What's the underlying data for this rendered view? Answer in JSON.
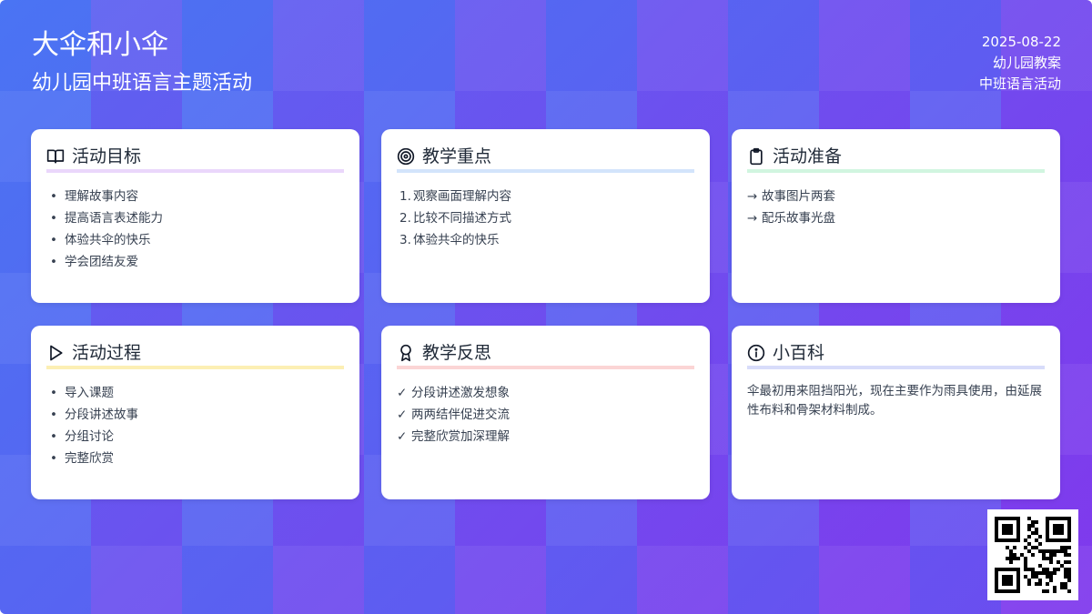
{
  "header": {
    "title": "大伞和小伞",
    "subtitle": "幼儿园中班语言主题活动",
    "date": "2025-08-22",
    "doc_type": "幼儿园教案",
    "activity_type": "中班语言活动"
  },
  "cards": {
    "goals": {
      "icon": "book-open-icon",
      "title": "活动目标",
      "items": [
        "理解故事内容",
        "提高语言表述能力",
        "体验共伞的快乐",
        "学会团结友爱"
      ]
    },
    "focus": {
      "icon": "target-icon",
      "title": "教学重点",
      "items": [
        {
          "num": "1.",
          "text": "观察画面理解内容"
        },
        {
          "num": "2.",
          "text": "比较不同描述方式"
        },
        {
          "num": "3.",
          "text": "体验共伞的快乐"
        }
      ]
    },
    "prep": {
      "icon": "clipboard-icon",
      "title": "活动准备",
      "items": [
        {
          "mark": "→",
          "text": "故事图片两套"
        },
        {
          "mark": "→",
          "text": "配乐故事光盘"
        }
      ]
    },
    "process": {
      "icon": "play-icon",
      "title": "活动过程",
      "items": [
        "导入课题",
        "分段讲述故事",
        "分组讨论",
        "完整欣赏"
      ]
    },
    "reflection": {
      "icon": "award-icon",
      "title": "教学反思",
      "items": [
        {
          "mark": "✓",
          "text": "分段讲述激发想象"
        },
        {
          "mark": "✓",
          "text": "两两结伴促进交流"
        },
        {
          "mark": "✓",
          "text": "完整欣赏加深理解"
        }
      ]
    },
    "trivia": {
      "icon": "info-icon",
      "title": "小百科",
      "text": "伞最初用来阻挡阳光，现在主要作为雨具使用，由延展性布料和骨架材料制成。"
    }
  },
  "colors": {
    "bg_start": "#4f6ff2",
    "bg_end": "#7c3aed",
    "card": "#ffffff",
    "goals_accent": "#ead7fb",
    "focus_accent": "#d3e4fb",
    "prep_accent": "#d1f5e0",
    "process_accent": "#fcefb4",
    "reflection_accent": "#fbd5d5",
    "trivia_accent": "#d8dcfa"
  },
  "qr": {
    "icon": "qr-code-icon"
  }
}
